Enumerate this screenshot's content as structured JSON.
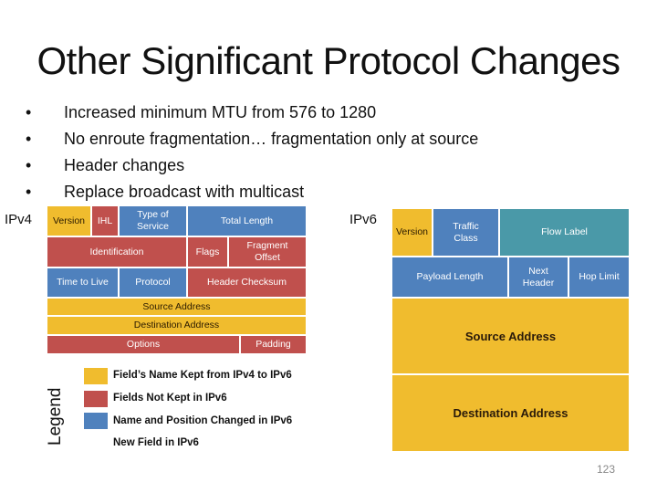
{
  "slide": {
    "title": "Other Significant Protocol Changes",
    "bullets": [
      "Increased minimum MTU from 576 to 1280",
      "No enroute fragmentation… fragmentation only at source",
      "Header changes",
      "Replace broadcast with multicast"
    ],
    "bullet_glyph": "•",
    "page_number": "123"
  },
  "colors": {
    "kept": "#F0BC2E",
    "not_kept": "#C0504D",
    "changed": "#4F81BD",
    "new": "#4A99A8"
  },
  "ipv4": {
    "label": "IPv4",
    "fields": {
      "version": "Version",
      "ihl": "IHL",
      "tos": "Type of Service",
      "total_length": "Total Length",
      "identification": "Identification",
      "flags": "Flags",
      "fragment_offset": "Fragment Offset",
      "ttl": "Time to Live",
      "protocol": "Protocol",
      "header_checksum": "Header Checksum",
      "source": "Source Address",
      "destination": "Destination Address",
      "options": "Options",
      "padding": "Padding"
    }
  },
  "ipv6": {
    "label": "IPv6",
    "fields": {
      "version": "Version",
      "traffic_class": "Traffic Class",
      "flow_label": "Flow Label",
      "payload_length": "Payload Length",
      "next_header": "Next Header",
      "hop_limit": "Hop Limit",
      "source": "Source Address",
      "destination": "Destination Address"
    }
  },
  "legend": {
    "title": "Legend",
    "items": [
      {
        "label": "Field’s Name Kept from IPv4 to IPv6",
        "color": "#F0BC2E"
      },
      {
        "label": "Fields Not Kept in IPv6",
        "color": "#C0504D"
      },
      {
        "label": "Name and Position Changed in IPv6",
        "color": "#4F81BD"
      },
      {
        "label": "New Field in IPv6",
        "color": null
      }
    ]
  }
}
